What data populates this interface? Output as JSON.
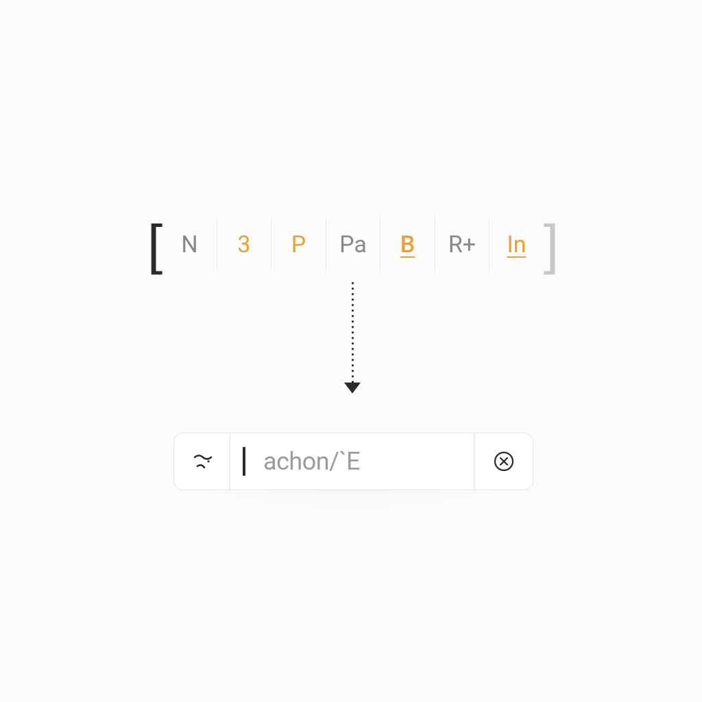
{
  "toolbar": {
    "items": [
      {
        "label": "N",
        "accent": false
      },
      {
        "label": "3",
        "accent": true
      },
      {
        "label": "P",
        "accent": true
      },
      {
        "label": "Pa",
        "accent": false
      },
      {
        "label": "B",
        "accent": true,
        "underline": true
      },
      {
        "label": "R+",
        "accent": false
      },
      {
        "label": "In",
        "accent": true,
        "underline": true
      }
    ]
  },
  "input": {
    "value": "achon/`E",
    "left_glyph": "≈·"
  },
  "colors": {
    "accent": "#e8a038",
    "muted": "#888888",
    "text": "#2a2a2a",
    "border": "#e5e5e5"
  }
}
